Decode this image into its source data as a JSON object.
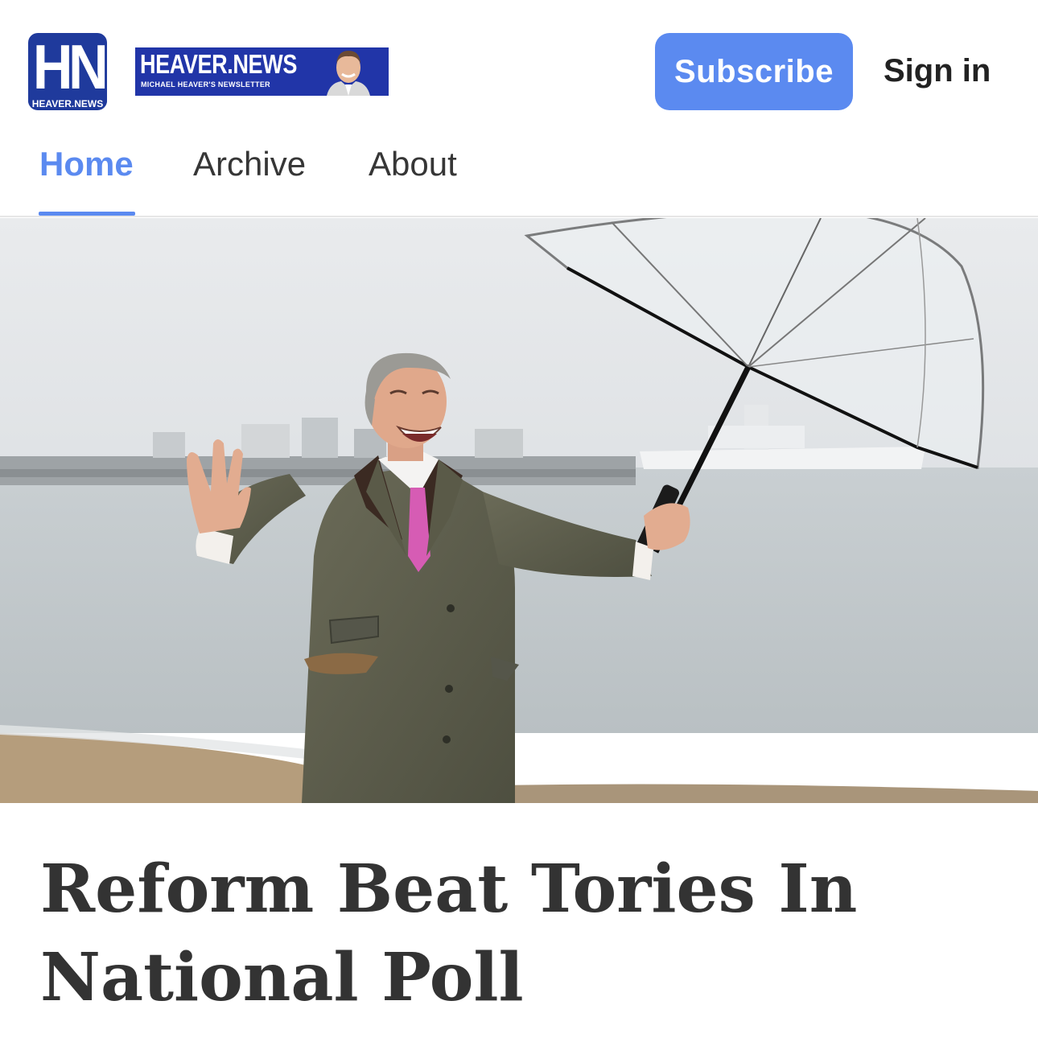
{
  "header": {
    "logo": {
      "letters": "HN",
      "caption": "HEAVER.NEWS",
      "bg_color": "#1f3a9c"
    },
    "banner": {
      "title": "HEAVER.NEWS",
      "subtitle": "MICHAEL HEAVER'S NEWSLETTER",
      "bg_color": "#2135a8"
    },
    "subscribe_label": "Subscribe",
    "signin_label": "Sign in",
    "accent_color": "#5b8af0"
  },
  "nav": {
    "items": [
      {
        "label": "Home",
        "active": true
      },
      {
        "label": "Archive",
        "active": false
      },
      {
        "label": "About",
        "active": false
      }
    ]
  },
  "article": {
    "hero_image": "man-with-umbrella-on-beach",
    "title": "Reform Beat Tories In National Poll"
  }
}
